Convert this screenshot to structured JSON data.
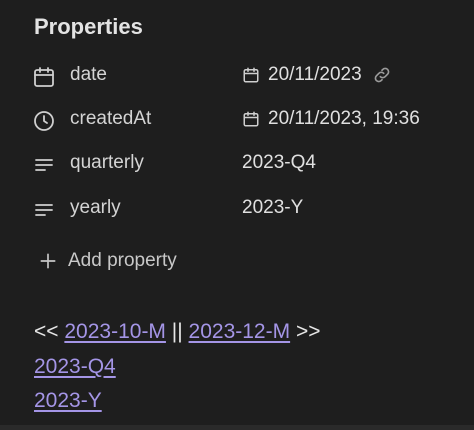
{
  "properties": {
    "heading": "Properties",
    "rows": [
      {
        "icon": "calendar-icon",
        "label": "date",
        "value": "20/11/2023",
        "value_icon": "calendar-icon",
        "trailing_icon": "link-icon"
      },
      {
        "icon": "clock-icon",
        "label": "createdAt",
        "value": "20/11/2023, 19:36",
        "value_icon": "calendar-icon"
      },
      {
        "icon": "text-lines-icon",
        "label": "quarterly",
        "value": "2023-Q4"
      },
      {
        "icon": "text-lines-icon",
        "label": "yearly",
        "value": "2023-Y"
      }
    ],
    "add_label": "Add property"
  },
  "nav": {
    "prefix": "<<",
    "prev_link": "2023-10-M",
    "separator": "||",
    "next_link": "2023-12-M",
    "suffix": ">>"
  },
  "links": [
    "2023-Q4",
    "2023-Y"
  ],
  "colors": {
    "background": "#1e1e1e",
    "link": "#a495e6",
    "text": "#dadada"
  }
}
